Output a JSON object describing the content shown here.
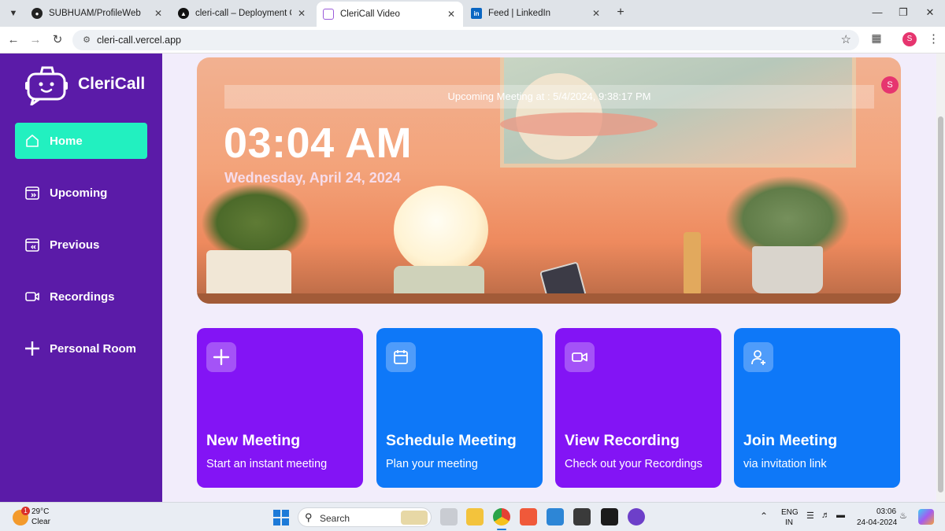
{
  "browser": {
    "tabs": [
      {
        "label": "SUBHUAM/ProfileWeb",
        "favicon": "github-icon",
        "active": false
      },
      {
        "label": "cleri-call – Deployment Overvi",
        "favicon": "vercel-icon",
        "active": false
      },
      {
        "label": "CleriCall Video",
        "favicon": "clericall-icon",
        "active": true
      },
      {
        "label": "Feed | LinkedIn",
        "favicon": "linkedin-icon",
        "active": false
      }
    ],
    "url": "cleri-call.vercel.app",
    "profile_initial": "S"
  },
  "sidebar": {
    "brand": "CleriCall",
    "items": [
      {
        "label": "Home",
        "icon": "home-icon",
        "active": true
      },
      {
        "label": "Upcoming",
        "icon": "calendar-upcoming-icon",
        "active": false
      },
      {
        "label": "Previous",
        "icon": "calendar-previous-icon",
        "active": false
      },
      {
        "label": "Recordings",
        "icon": "video-icon",
        "active": false
      },
      {
        "label": "Personal Room",
        "icon": "plus-icon",
        "active": false
      }
    ]
  },
  "hero": {
    "upcoming": "Upcoming Meeting at : 5/4/2024, 9:38:17 PM",
    "time": "03:04 AM",
    "date": "Wednesday, April 24, 2024",
    "avatar_initial": "S"
  },
  "cards": [
    {
      "title": "New Meeting",
      "subtitle": "Start an instant meeting",
      "icon": "plus-icon",
      "color": "#8314f5"
    },
    {
      "title": "Schedule Meeting",
      "subtitle": "Plan your meeting",
      "icon": "calendar-icon",
      "color": "#0e78f8"
    },
    {
      "title": "View Recording",
      "subtitle": "Check out your Recordings",
      "icon": "video-icon",
      "color": "#8314f5"
    },
    {
      "title": "Join Meeting",
      "subtitle": "via invitation link",
      "icon": "user-plus-icon",
      "color": "#0e78f8"
    }
  ],
  "colors": {
    "sidebar_bg": "#5b1ba8",
    "active_nav": "#22f0c0",
    "card_purple": "#8314f5",
    "card_blue": "#0e78f8",
    "page_bg": "#f2edfb"
  },
  "taskbar": {
    "weather_temp": "29°C",
    "weather_cond": "Clear",
    "weather_badge": "1",
    "search_label": "Search",
    "lang_primary": "ENG",
    "lang_secondary": "IN",
    "time": "03:06",
    "date": "24-04-2024"
  }
}
